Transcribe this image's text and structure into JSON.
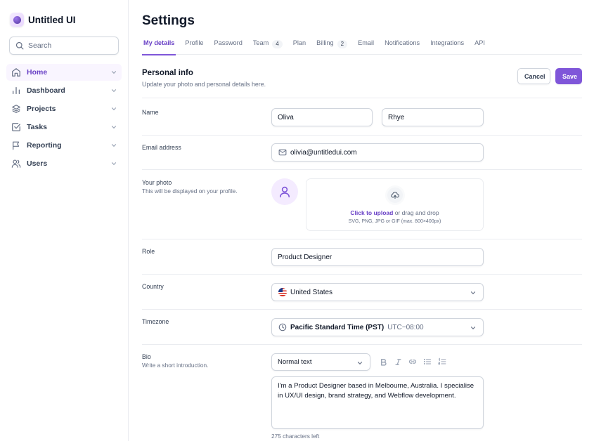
{
  "sidebar": {
    "app_name": "Untitled UI",
    "search_placeholder": "Search",
    "nav": [
      {
        "label": "Home",
        "icon": "home-icon",
        "active": true
      },
      {
        "label": "Dashboard",
        "icon": "bar-chart-icon"
      },
      {
        "label": "Projects",
        "icon": "layers-icon"
      },
      {
        "label": "Tasks",
        "icon": "check-square-icon"
      },
      {
        "label": "Reporting",
        "icon": "flag-icon"
      },
      {
        "label": "Users",
        "icon": "users-icon"
      }
    ]
  },
  "header": {
    "title": "Settings",
    "tabs": [
      {
        "label": "My details",
        "active": true
      },
      {
        "label": "Profile"
      },
      {
        "label": "Password"
      },
      {
        "label": "Team",
        "badge": "4"
      },
      {
        "label": "Plan"
      },
      {
        "label": "Billing",
        "badge": "2"
      },
      {
        "label": "Email"
      },
      {
        "label": "Notifications"
      },
      {
        "label": "Integrations"
      },
      {
        "label": "API"
      }
    ]
  },
  "personal_info": {
    "title": "Personal info",
    "subtitle": "Update your photo and personal details here.",
    "cancel_label": "Cancel",
    "save_label": "Save"
  },
  "form": {
    "name": {
      "label": "Name",
      "first": "Oliva",
      "last": "Rhye"
    },
    "email": {
      "label": "Email address",
      "value": "olivia@untitledui.com"
    },
    "photo": {
      "label": "Your photo",
      "sub": "This will be displayed on your profile.",
      "upload_link": "Click to upload",
      "upload_text": " or drag and drop",
      "upload_hint": "SVG, PNG, JPG or GIF (max. 800×400px)"
    },
    "role": {
      "label": "Role",
      "value": "Product Designer"
    },
    "country": {
      "label": "Country",
      "value": "United States"
    },
    "timezone": {
      "label": "Timezone",
      "value": "Pacific Standard Time (PST)",
      "offset": "UTC−08:00"
    },
    "bio": {
      "label": "Bio",
      "sub": "Write a short introduction.",
      "format": "Normal text",
      "value": "I'm a Product Designer based in Melbourne, Australia. I specialise in UX/UI design, brand strategy, and Webflow development.",
      "hint": "275 characters left"
    }
  },
  "colors": {
    "accent": "#7f56d9",
    "accent_text": "#6941c6",
    "active_bg": "#f9f5ff",
    "border": "#d0d5dd",
    "divider": "#eaecf0"
  }
}
